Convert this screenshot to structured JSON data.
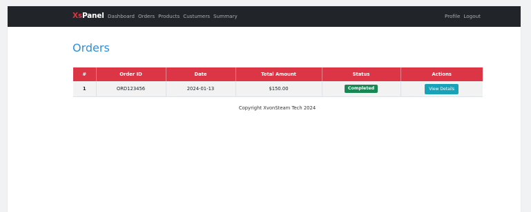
{
  "navbar": {
    "brand_xs": "Xs",
    "brand_panel": "Panel",
    "links": [
      "Dashboard",
      "Orders",
      "Products",
      "Custumers",
      "Summary"
    ],
    "right_links": [
      "Profile",
      "Logout"
    ]
  },
  "page": {
    "title": "Orders"
  },
  "table": {
    "headers": [
      "#",
      "Order ID",
      "Date",
      "Total Amount",
      "Status",
      "Actions"
    ],
    "rows": [
      {
        "num": "1",
        "order_id": "ORD123456",
        "date": "2024-01-13",
        "total": "$150.00",
        "status": "Completed",
        "action": "View Details"
      }
    ]
  },
  "footer": {
    "text": "Copyright XvonSteam Tech 2024"
  },
  "colors": {
    "brand_accent": "#dc3545",
    "navbar_bg": "#212529",
    "title": "#2f8fdc",
    "table_header": "#dc3545",
    "status_completed": "#198754",
    "button_info": "#17a2b8"
  }
}
